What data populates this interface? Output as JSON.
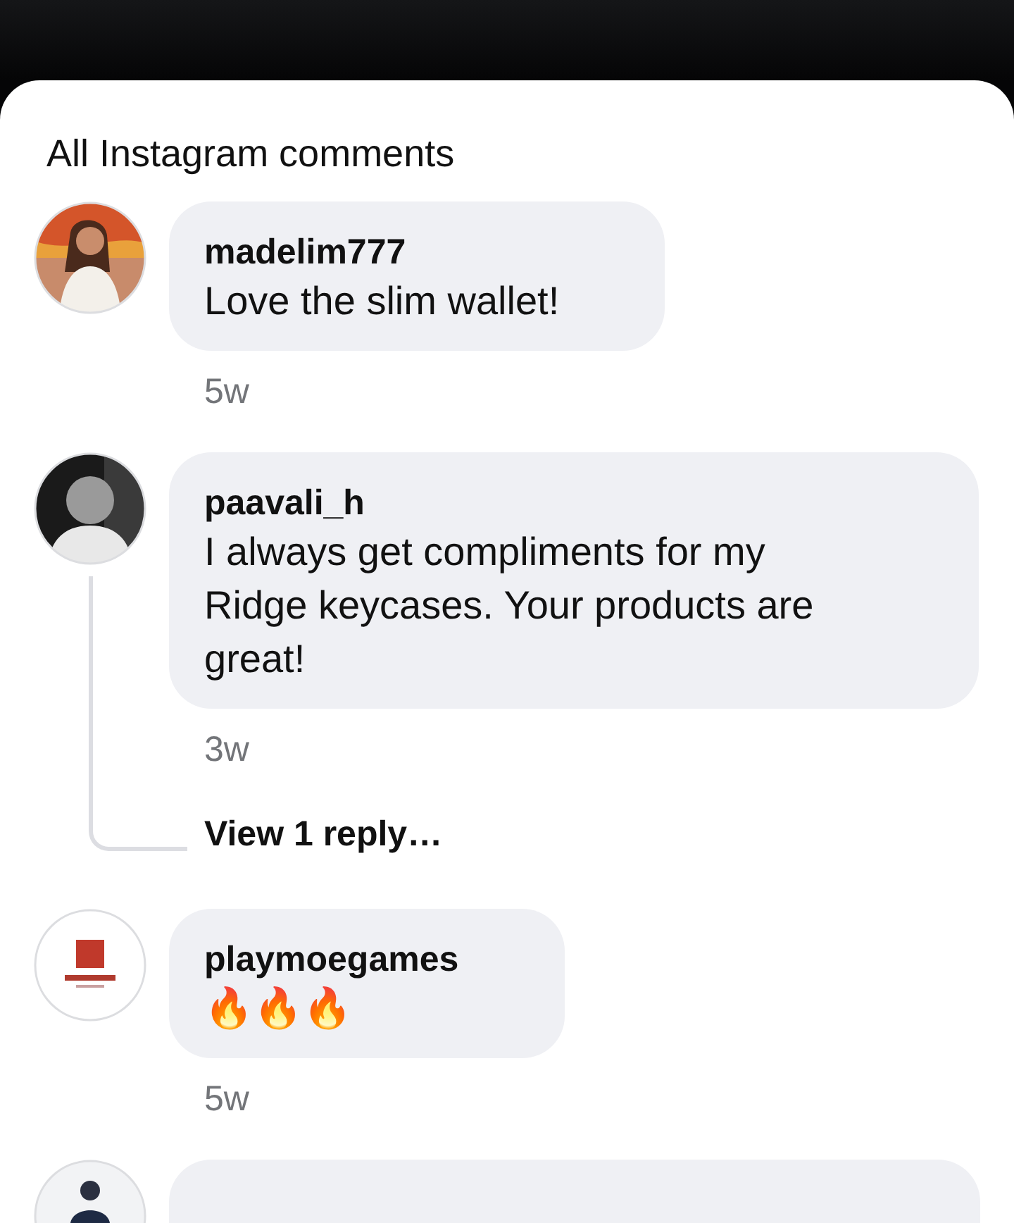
{
  "sheet": {
    "title": "All Instagram comments"
  },
  "comments": [
    {
      "username": "madelim777",
      "text": "Love the slim wallet!",
      "time": "5w"
    },
    {
      "username": "paavali_h",
      "text": "I always get compliments for my Ridge keycases. Your products are great!",
      "time": "3w",
      "replies_link": "View 1 reply…"
    },
    {
      "username": "playmoegames",
      "text": "🔥🔥🔥",
      "time": "5w"
    }
  ],
  "more_below": true
}
